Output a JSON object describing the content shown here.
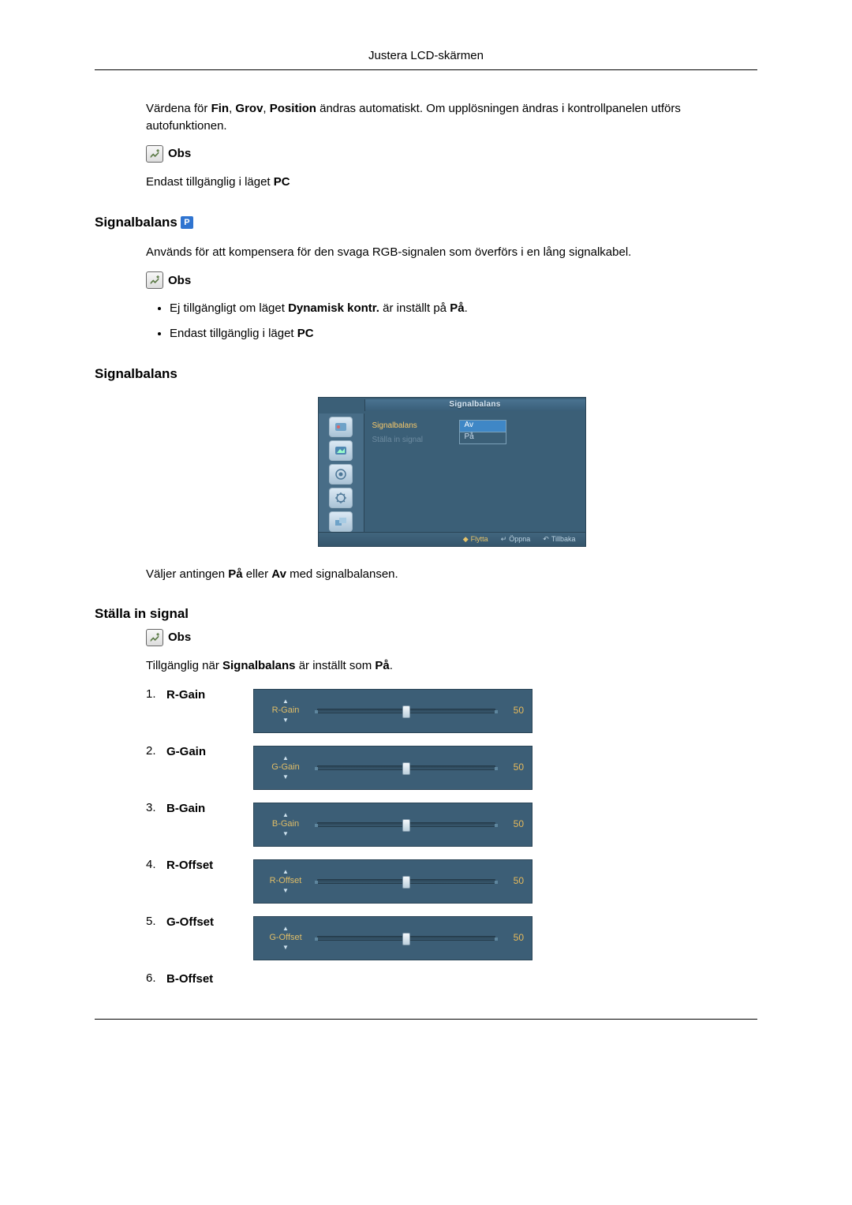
{
  "header": {
    "title": "Justera LCD-skärmen"
  },
  "intro": {
    "para1_a": "Värdena för ",
    "bold_fin": "Fin",
    "sep1": ", ",
    "bold_grov": "Grov",
    "sep2": ", ",
    "bold_position": "Position",
    "para1_b": " ändras automatiskt. Om upplösningen ändras i kontrollpanelen utförs autofunktionen.",
    "obs": "Obs",
    "para2_a": "Endast tillgänglig i läget ",
    "bold_pc": "PC"
  },
  "sec1": {
    "title": "Signalbalans",
    "para1": "Används för att kompensera för den svaga RGB-signalen som överförs i en lång signalkabel.",
    "obs": "Obs",
    "bullet1_a": "Ej tillgängligt om läget ",
    "bullet1_b": "Dynamisk kontr.",
    "bullet1_c": " är inställt på ",
    "bullet1_d": "På",
    "bullet1_e": ".",
    "bullet2_a": "Endast tillgänglig i läget ",
    "bullet2_b": "PC"
  },
  "sec2": {
    "title": "Signalbalans",
    "osd": {
      "header": "Signalbalans",
      "item1": "Signalbalans",
      "item2": "Ställa in signal",
      "opt_off": "Av",
      "opt_on": "På",
      "footer_move": "Flytta",
      "footer_open": "Öppna",
      "footer_back": "Tillbaka"
    },
    "para_a": "Väljer antingen ",
    "para_b": "På",
    "para_c": " eller ",
    "para_d": "Av",
    "para_e": " med signalbalansen."
  },
  "sec3": {
    "title": "Ställa in signal",
    "obs": "Obs",
    "para_a": "Tillgänglig när ",
    "para_b": "Signalbalans",
    "para_c": " är inställt som ",
    "para_d": "På",
    "para_e": ".",
    "items": [
      {
        "num": "1.",
        "label": "R-Gain",
        "slider_label": "R-Gain",
        "value": "50"
      },
      {
        "num": "2.",
        "label": "G-Gain",
        "slider_label": "G-Gain",
        "value": "50"
      },
      {
        "num": "3.",
        "label": "B-Gain",
        "slider_label": "B-Gain",
        "value": "50"
      },
      {
        "num": "4.",
        "label": "R-Offset",
        "slider_label": "R-Offset",
        "value": "50"
      },
      {
        "num": "5.",
        "label": "G-Offset",
        "slider_label": "G-Offset",
        "value": "50"
      },
      {
        "num": "6.",
        "label": "B-Offset",
        "slider_label": "",
        "value": ""
      }
    ]
  }
}
